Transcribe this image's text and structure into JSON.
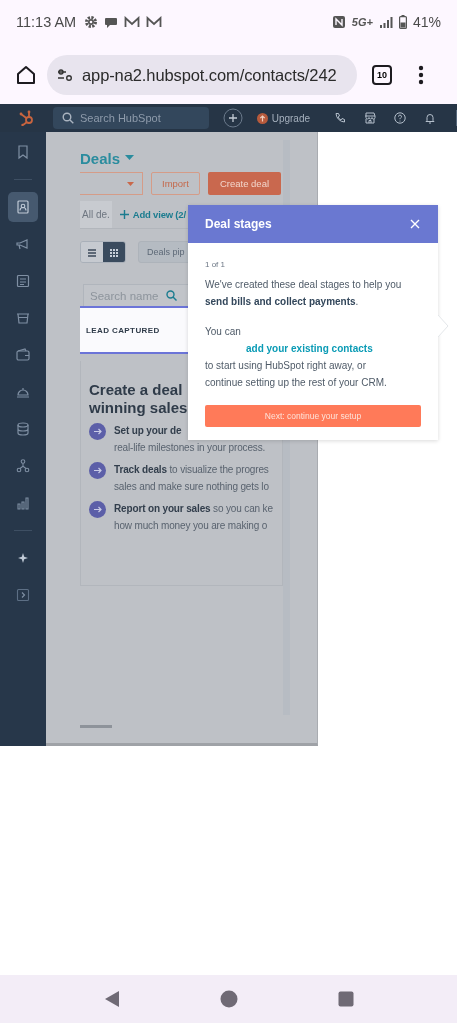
{
  "status_bar": {
    "time": "11:13 AM",
    "network": "5G+",
    "battery": "41%"
  },
  "browser": {
    "url": "app-na2.hubspot.com/contacts/242",
    "tab_count": "10"
  },
  "top_nav": {
    "search": {
      "placeholder": "Search HubSpot"
    },
    "upgrade": "Upgrade"
  },
  "sidebar": {
    "items": [
      {
        "selected": false
      },
      {
        "selected": true
      },
      {
        "selected": false
      },
      {
        "selected": false
      },
      {
        "selected": false
      },
      {
        "selected": false
      },
      {
        "selected": false
      },
      {
        "selected": false
      },
      {
        "selected": false
      },
      {
        "selected": false
      },
      {
        "selected": false
      },
      {
        "selected": false
      }
    ]
  },
  "page": {
    "title": "Deals",
    "buttons": [
      {
        "label": "Import",
        "kind": "outline"
      },
      {
        "label": "Create deal",
        "kind": "primary"
      }
    ],
    "views": {
      "tab": "All de.",
      "add": "Add view (2/"
    },
    "view_toggle": [
      {
        "selected": false
      },
      {
        "selected": true
      }
    ],
    "pipeline": "Deals pip",
    "board_search": {
      "placeholder": "Search name"
    },
    "column": {
      "title": "LEAD CAPTURED",
      "highlighted": true
    },
    "empty_state": {
      "heading": [
        "Create a deal",
        "winning sales"
      ],
      "items": [
        {
          "lines": [
            "**Set up your de**",
            "real-life milestones in your process."
          ]
        },
        {
          "lines": [
            "**Track deals** to visualize the progres",
            "sales and make sure nothing gets lo"
          ]
        },
        {
          "lines": [
            "**Report on your sales** so you can ke",
            "how much money you are making o"
          ]
        }
      ]
    }
  },
  "popover": {
    "title": "Deal stages",
    "step": "1 of 1",
    "intro": "We've created these deal stages to help you **send bills and collect payments**.",
    "lead": "You can",
    "link": "add your existing contacts",
    "rest": "to start using HubSpot right away, or continue setting up the rest of your CRM.",
    "button": "Next: continue your setup"
  }
}
